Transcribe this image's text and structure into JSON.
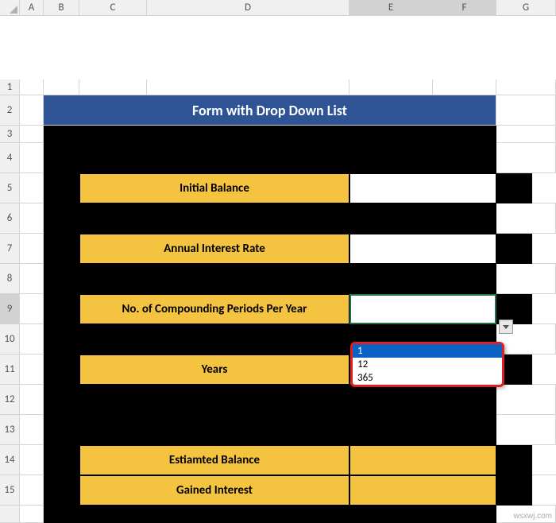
{
  "columns": [
    "A",
    "B",
    "C",
    "D",
    "E",
    "F",
    "G"
  ],
  "rows": [
    "1",
    "2",
    "3",
    "4",
    "5",
    "6",
    "7",
    "8",
    "9",
    "10",
    "11",
    "12",
    "13",
    "14",
    "15"
  ],
  "selected_row": "9",
  "selected_cols": [
    "E",
    "F"
  ],
  "title": "Form with Drop Down List",
  "labels": {
    "initial_balance": "Initial Balance",
    "annual_rate": "Annual Interest Rate",
    "periods": "No. of Compounding Periods Per Year",
    "years": "Years",
    "est_balance": "Estiamted Balance",
    "gained_interest": "Gained Interest"
  },
  "inputs": {
    "initial_balance": "",
    "annual_rate": "",
    "periods": "",
    "years": "",
    "est_balance": "",
    "gained_interest": ""
  },
  "dropdown": {
    "options": [
      "1",
      "12",
      "365"
    ],
    "highlighted": "1"
  },
  "watermark": "wsxwj.com"
}
